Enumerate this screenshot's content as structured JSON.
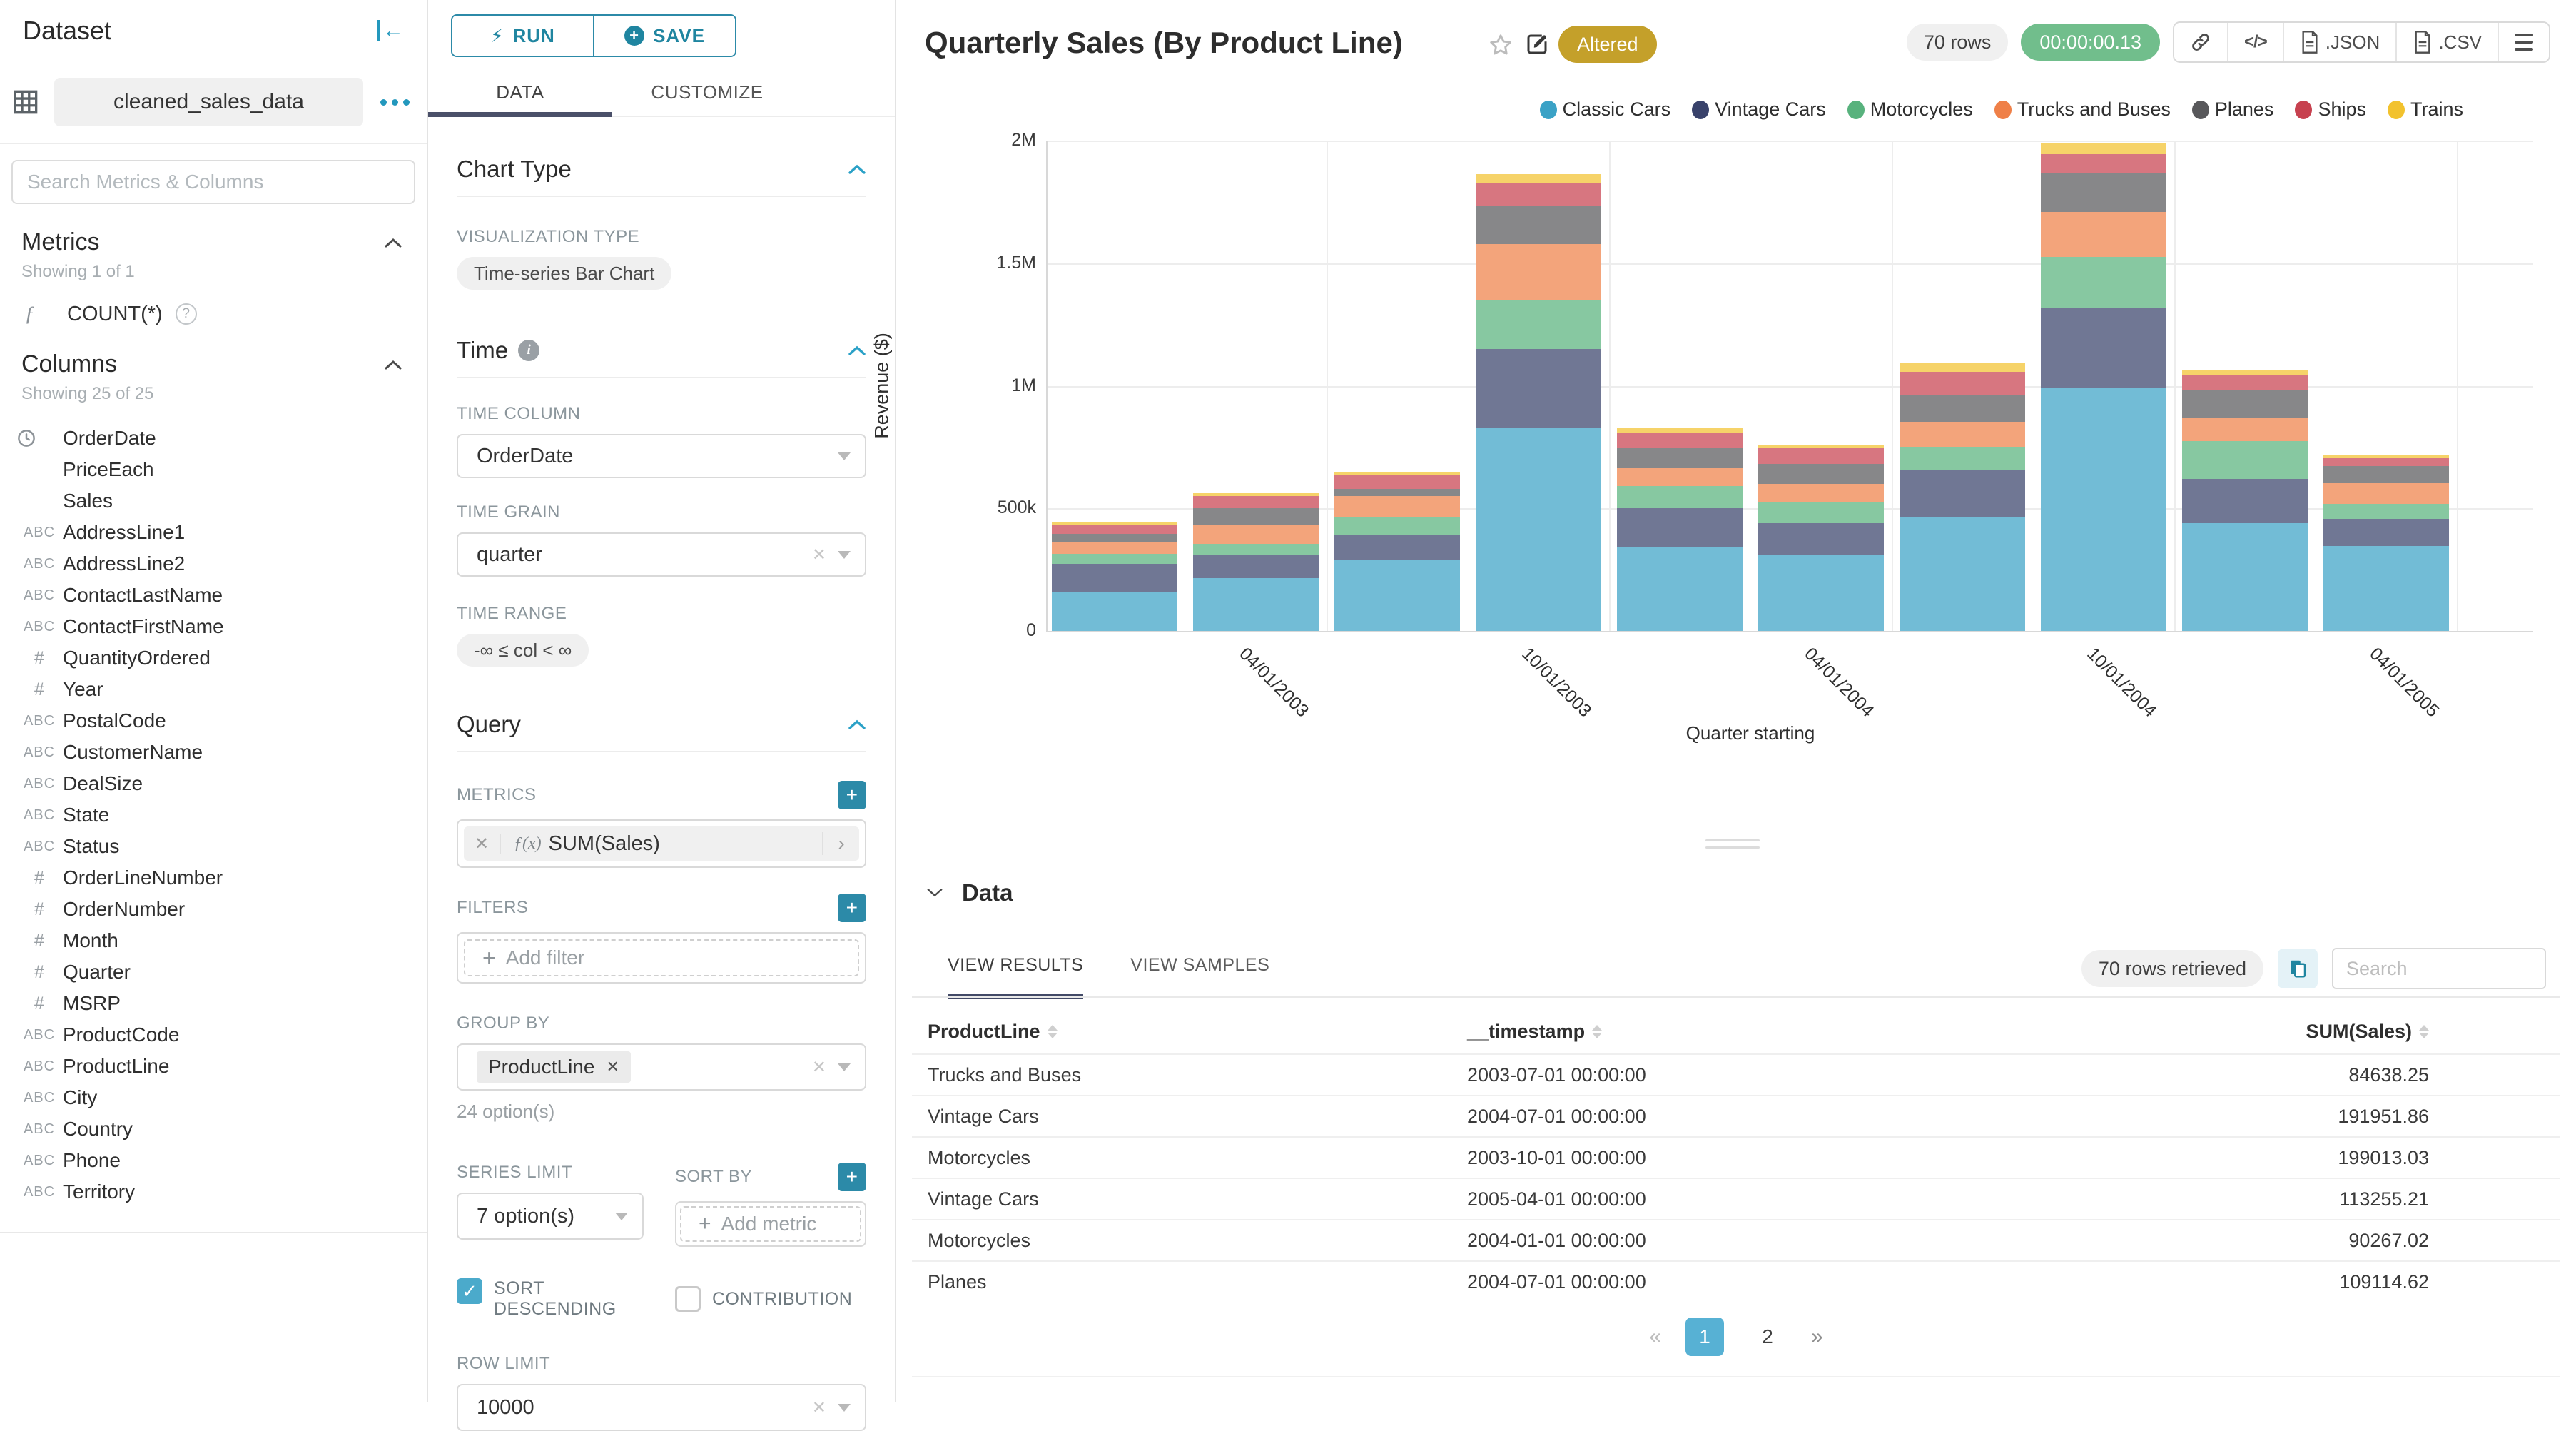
{
  "colors": {
    "accent_teal": "#1f85a0",
    "tab_ink_indigo": "#4a5069",
    "altered_badge": "#c4a02a",
    "timer_badge": "#71be8c",
    "active_page": "#57b1d4",
    "checkbox_checked": "#4baacb"
  },
  "sidebar": {
    "title": "Dataset",
    "dataset_name": "cleaned_sales_data",
    "search_placeholder": "Search Metrics & Columns",
    "metrics": {
      "title": "Metrics",
      "showing": "Showing 1 of 1",
      "items": [
        {
          "icon": "function",
          "label": "COUNT(*)"
        }
      ]
    },
    "columns": {
      "title": "Columns",
      "showing": "Showing 25 of 25",
      "items": [
        {
          "type": "time",
          "label": "OrderDate"
        },
        {
          "type": "none",
          "label": "PriceEach"
        },
        {
          "type": "none",
          "label": "Sales"
        },
        {
          "type": "abc",
          "label": "AddressLine1"
        },
        {
          "type": "abc",
          "label": "AddressLine2"
        },
        {
          "type": "abc",
          "label": "ContactLastName"
        },
        {
          "type": "abc",
          "label": "ContactFirstName"
        },
        {
          "type": "num",
          "label": "QuantityOrdered"
        },
        {
          "type": "num",
          "label": "Year"
        },
        {
          "type": "abc",
          "label": "PostalCode"
        },
        {
          "type": "abc",
          "label": "CustomerName"
        },
        {
          "type": "abc",
          "label": "DealSize"
        },
        {
          "type": "abc",
          "label": "State"
        },
        {
          "type": "abc",
          "label": "Status"
        },
        {
          "type": "num",
          "label": "OrderLineNumber"
        },
        {
          "type": "num",
          "label": "OrderNumber"
        },
        {
          "type": "num",
          "label": "Month"
        },
        {
          "type": "num",
          "label": "Quarter"
        },
        {
          "type": "num",
          "label": "MSRP"
        },
        {
          "type": "abc",
          "label": "ProductCode"
        },
        {
          "type": "abc",
          "label": "ProductLine"
        },
        {
          "type": "abc",
          "label": "City"
        },
        {
          "type": "abc",
          "label": "Country"
        },
        {
          "type": "abc",
          "label": "Phone"
        },
        {
          "type": "abc",
          "label": "Territory"
        }
      ]
    }
  },
  "panel": {
    "run_label": "RUN",
    "save_label": "SAVE",
    "tabs": {
      "data": "DATA",
      "customize": "CUSTOMIZE"
    },
    "chart_type": {
      "title": "Chart Type",
      "viz_label": "VISUALIZATION TYPE",
      "viz_value": "Time-series Bar Chart"
    },
    "time": {
      "title": "Time",
      "column_label": "TIME COLUMN",
      "column_value": "OrderDate",
      "grain_label": "TIME GRAIN",
      "grain_value": "quarter",
      "range_label": "TIME RANGE",
      "range_value": "-∞ ≤ col < ∞"
    },
    "query": {
      "title": "Query",
      "metrics_label": "METRICS",
      "metric_prefix": "ƒ(x)",
      "metric_value": "SUM(Sales)",
      "filters_label": "FILTERS",
      "add_filter": "Add filter",
      "groupby_label": "GROUP BY",
      "groupby_value": "ProductLine",
      "groupby_options": "24 option(s)",
      "series_limit_label": "SERIES LIMIT",
      "series_limit_value": "7 option(s)",
      "sort_by_label": "SORT BY",
      "add_metric": "Add metric",
      "sort_descending_label": "SORT DESCENDING",
      "contribution_label": "CONTRIBUTION",
      "row_limit_label": "ROW LIMIT",
      "row_limit_value": "10000"
    }
  },
  "header": {
    "title": "Quarterly Sales (By Product Line)",
    "altered_badge": "Altered",
    "rows_badge": "70 rows",
    "timer_badge": "00:00:00.13",
    "export_json": ".JSON",
    "export_csv": ".CSV",
    "code_icon_text": "</>"
  },
  "chart_data": {
    "type": "bar",
    "stacked": true,
    "title": "Quarterly Sales (By Product Line)",
    "xlabel": "Quarter starting",
    "ylabel": "Revenue ($)",
    "ylim": [
      0,
      2000000
    ],
    "grid": true,
    "legend_position": "top-right",
    "ytick_labels": [
      "0",
      "500k",
      "1M",
      "1.5M",
      "2M"
    ],
    "x": [
      "2003-01-01",
      "2003-04-01",
      "2003-07-01",
      "2003-10-01",
      "2004-01-01",
      "2004-04-01",
      "2004-07-01",
      "2004-10-01",
      "2005-01-01",
      "2005-04-01"
    ],
    "xticks": [
      {
        "label": "04/01/2003",
        "after_bar": 2
      },
      {
        "label": "10/01/2003",
        "after_bar": 4
      },
      {
        "label": "04/01/2004",
        "after_bar": 6
      },
      {
        "label": "10/01/2004",
        "after_bar": 8
      },
      {
        "label": "04/01/2005",
        "after_bar": 10
      }
    ],
    "series": [
      {
        "name": "Classic Cars",
        "color": "#3ba2c6",
        "values": [
          160000,
          215000,
          290000,
          830000,
          340000,
          310000,
          465000,
          990000,
          440000,
          345000
        ]
      },
      {
        "name": "Vintage Cars",
        "color": "#39426b",
        "values": [
          115000,
          95000,
          100000,
          320000,
          160000,
          130000,
          191951.86,
          330000,
          180000,
          113255.21
        ]
      },
      {
        "name": "Motorcycles",
        "color": "#58b27d",
        "values": [
          40000,
          45000,
          75000,
          199013.03,
          90267.02,
          85000,
          95000,
          205000,
          155000,
          60000
        ]
      },
      {
        "name": "Trucks and Buses",
        "color": "#ef8048",
        "values": [
          45000,
          75000,
          84638.25,
          230000,
          75000,
          75000,
          100000,
          185000,
          95000,
          85000
        ]
      },
      {
        "name": "Planes",
        "color": "#58585b",
        "values": [
          35000,
          70000,
          30000,
          155000,
          80000,
          80000,
          109114.62,
          155000,
          110000,
          70000
        ]
      },
      {
        "name": "Ships",
        "color": "#c7414f",
        "values": [
          35000,
          50000,
          55000,
          95000,
          65000,
          65000,
          95000,
          80000,
          65000,
          30000
        ]
      },
      {
        "name": "Trains",
        "color": "#f2c22e",
        "values": [
          15000,
          12000,
          15000,
          35000,
          20000,
          15000,
          35000,
          45000,
          20000,
          12000
        ]
      }
    ]
  },
  "datapanel": {
    "title": "Data",
    "tab_results": "VIEW RESULTS",
    "tab_samples": "VIEW SAMPLES",
    "rows_retrieved": "70 rows retrieved",
    "search_placeholder": "Search",
    "columns": [
      "ProductLine",
      "__timestamp",
      "SUM(Sales)"
    ],
    "rows": [
      [
        "Trucks and Buses",
        "2003-07-01 00:00:00",
        "84638.25"
      ],
      [
        "Vintage Cars",
        "2004-07-01 00:00:00",
        "191951.86"
      ],
      [
        "Motorcycles",
        "2003-10-01 00:00:00",
        "199013.03"
      ],
      [
        "Vintage Cars",
        "2005-04-01 00:00:00",
        "113255.21"
      ],
      [
        "Motorcycles",
        "2004-01-01 00:00:00",
        "90267.02"
      ],
      [
        "Planes",
        "2004-07-01 00:00:00",
        "109114.62"
      ]
    ],
    "pagination": {
      "prev": "«",
      "pages": [
        "1",
        "2"
      ],
      "active": "1",
      "next": "»"
    }
  }
}
